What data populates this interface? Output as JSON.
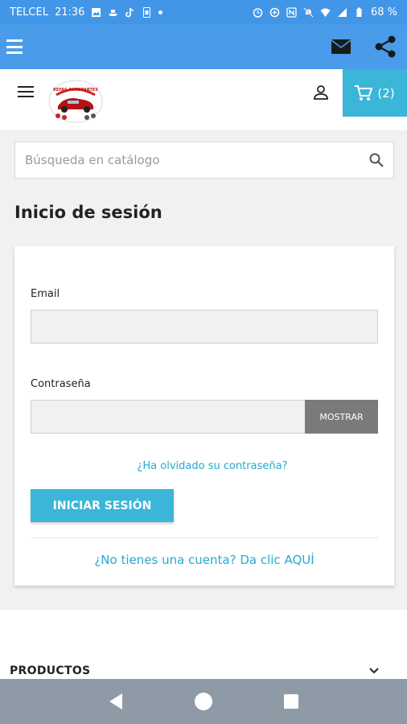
{
  "status_bar": {
    "carrier": "TELCEL",
    "time": "21:36",
    "battery": "68 %"
  },
  "app_bar": {
    "menu_icon": "hamburger-icon",
    "mail_icon": "mail-icon",
    "share_icon": "share-icon"
  },
  "header": {
    "cart_count": "(2)"
  },
  "search": {
    "placeholder": "Búsqueda en catálogo"
  },
  "page": {
    "title": "Inicio de sesión"
  },
  "login_form": {
    "email_label": "Email",
    "email_value": "",
    "password_label": "Contraseña",
    "password_value": "",
    "show_button": "MOSTRAR",
    "forgot_link": "¿Ha olvidado su contraseña?",
    "login_button": "INICIAR SESIÓN",
    "register_link": "¿No tienes una cuenta? Da clic AQUÍ"
  },
  "footer": {
    "products_label": "PRODUCTOS"
  },
  "colors": {
    "status_bar": "#4196e8",
    "app_bar": "#4a9be9",
    "accent": "#3bb5d8",
    "link": "#24a9d3",
    "show_button": "#7a7a7a"
  }
}
